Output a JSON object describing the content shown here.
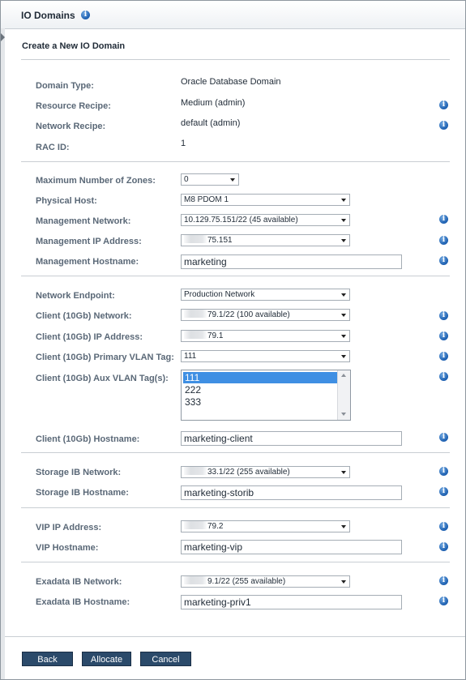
{
  "window": {
    "title": "IO Domains"
  },
  "form": {
    "heading": "Create a New IO Domain",
    "domain_type": {
      "label": "Domain Type:",
      "value": "Oracle Database Domain"
    },
    "resource_recipe": {
      "label": "Resource Recipe:",
      "value": "Medium (admin)"
    },
    "network_recipe": {
      "label": "Network Recipe:",
      "value": "default (admin)"
    },
    "rac_id": {
      "label": "RAC ID:",
      "value": "1"
    },
    "max_zones": {
      "label": "Maximum Number of Zones:",
      "value": "0"
    },
    "physical_host": {
      "label": "Physical Host:",
      "value": "M8 PDOM 1"
    },
    "mgmt_network": {
      "label": "Management Network:",
      "value": "10.129.75.151/22 (45 available)"
    },
    "mgmt_ip": {
      "label": "Management IP Address:",
      "value": "75.151"
    },
    "mgmt_hostname": {
      "label": "Management Hostname:",
      "value": "marketing"
    },
    "network_endpoint": {
      "label": "Network Endpoint:",
      "value": "Production Network"
    },
    "client_network": {
      "label": "Client (10Gb) Network:",
      "value": "79.1/22 (100 available)"
    },
    "client_ip": {
      "label": "Client (10Gb) IP Address:",
      "value": "79.1"
    },
    "client_primary_vlan": {
      "label": "Client (10Gb) Primary VLAN Tag:",
      "value": "111"
    },
    "client_aux_vlan": {
      "label": "Client (10Gb) Aux VLAN Tag(s):",
      "options": [
        "111",
        "222",
        "333"
      ],
      "selected": "111"
    },
    "client_hostname": {
      "label": "Client (10Gb) Hostname:",
      "value": "marketing-client"
    },
    "storage_ib_network": {
      "label": "Storage IB Network:",
      "value": "33.1/22 (255 available)"
    },
    "storage_ib_hostname": {
      "label": "Storage IB Hostname:",
      "value": "marketing-storib"
    },
    "vip_ip": {
      "label": "VIP IP Address:",
      "value": "79.2"
    },
    "vip_hostname": {
      "label": "VIP Hostname:",
      "value": "marketing-vip"
    },
    "exadata_ib_network": {
      "label": "Exadata IB Network:",
      "value": "9.1/22 (255 available)"
    },
    "exadata_ib_hostname": {
      "label": "Exadata IB Hostname:",
      "value": "marketing-priv1"
    }
  },
  "buttons": {
    "back": "Back",
    "allocate": "Allocate",
    "cancel": "Cancel"
  },
  "icons": {
    "info": "info-icon",
    "dropdown": "chevron-down-icon"
  },
  "colors": {
    "button_bg": "#2b4a6a",
    "info_icon": "#1c5fb0",
    "selection": "#3f8fe3",
    "label": "#5a6877"
  }
}
